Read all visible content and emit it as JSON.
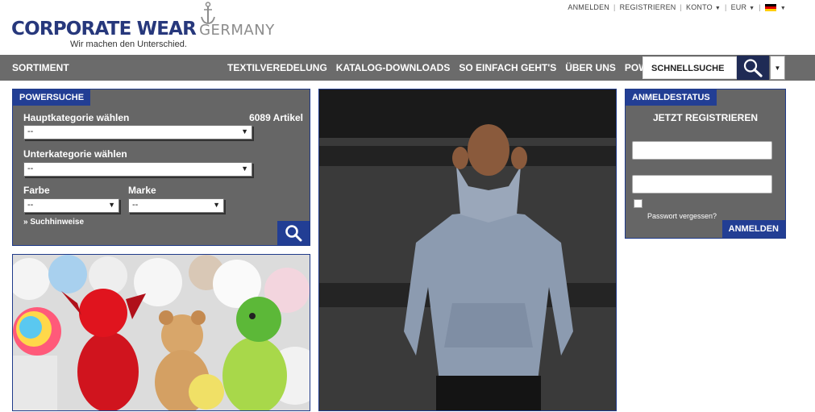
{
  "brand": {
    "name_main": "CORPORATE WEAR",
    "name_suffix": "GERMANY",
    "tagline": "Wir machen den Unterschied."
  },
  "topnav": {
    "login": "ANMELDEN",
    "register": "REGISTRIEREN",
    "account": "KONTO",
    "currency": "EUR",
    "language_icon": "german-flag-icon"
  },
  "mainnav": {
    "sortiment": "SORTIMENT",
    "items": [
      "TEXTILVEREDELUNG",
      "KATALOG-DOWNLOADS",
      "SO EINFACH GEHT'S",
      "ÜBER UNS",
      "POWERSUCHE"
    ],
    "quick_search_label": "SCHNELLSUCHE"
  },
  "powersearch": {
    "tag": "POWERSUCHE",
    "main_category_label": "Hauptkategorie wählen",
    "article_count": "6089 Artikel",
    "main_category_value": "--",
    "sub_category_label": "Unterkategorie wählen",
    "sub_category_value": "--",
    "color_label": "Farbe",
    "color_value": "--",
    "brand_label": "Marke",
    "brand_value": "--",
    "hints_link": "» Suchhinweise"
  },
  "login_panel": {
    "tag": "ANMELDESTATUS",
    "title": "JETZT REGISTRIEREN",
    "forgot": "Passwort vergessen?",
    "submit": "ANMELDEN"
  },
  "colors": {
    "brand_blue": "#223e94",
    "nav_gray": "#6b6b6b",
    "panel_gray": "#666666"
  }
}
